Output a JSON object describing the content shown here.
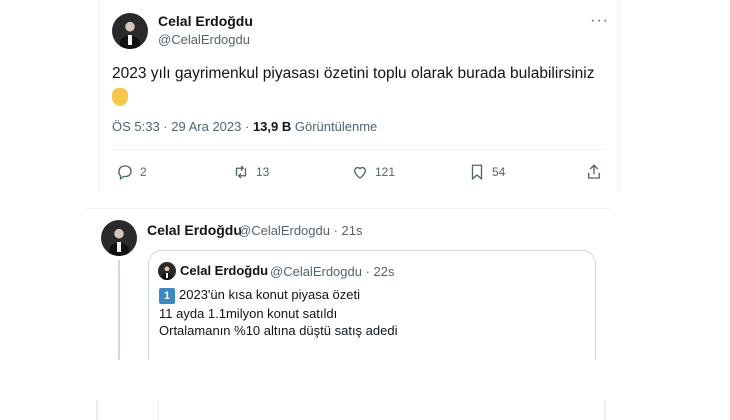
{
  "main_tweet": {
    "author_name": "Celal Erdoğdu",
    "author_handle": "@CelalErdogdu",
    "text": "2023 yılı gayrimenkul piyasası özetini toplu olarak burada bulabilirsiniz",
    "emoji_icon": "pointing-down-hand-icon",
    "time": "ÖS 5:33 · 29 Ara 2023 ·",
    "views": "13,9 B",
    "views_label": "Görüntülenme",
    "actions": {
      "replies": "2",
      "retweets": "13",
      "likes": "121",
      "bookmarks": "54"
    }
  },
  "reply_tweet": {
    "author_name": "Celal Erdoğdu",
    "author_handle": "@CelalErdogdu · 21s"
  },
  "quoted_tweet": {
    "author_name": "Celal Erdoğdu",
    "author_handle": "@CelalErdogdu · 22s",
    "number_badge": "1",
    "line1": "2023'ün kısa konut piyasa özeti",
    "line2": "11 ayda 1.1milyon konut satıldı",
    "line3": "Ortalamanın %10 altına düştü satış adedi"
  },
  "colors": {
    "text": "#0f1419",
    "secondary": "#536471",
    "border": "#cfd9de",
    "badge": "#3b88c3"
  }
}
